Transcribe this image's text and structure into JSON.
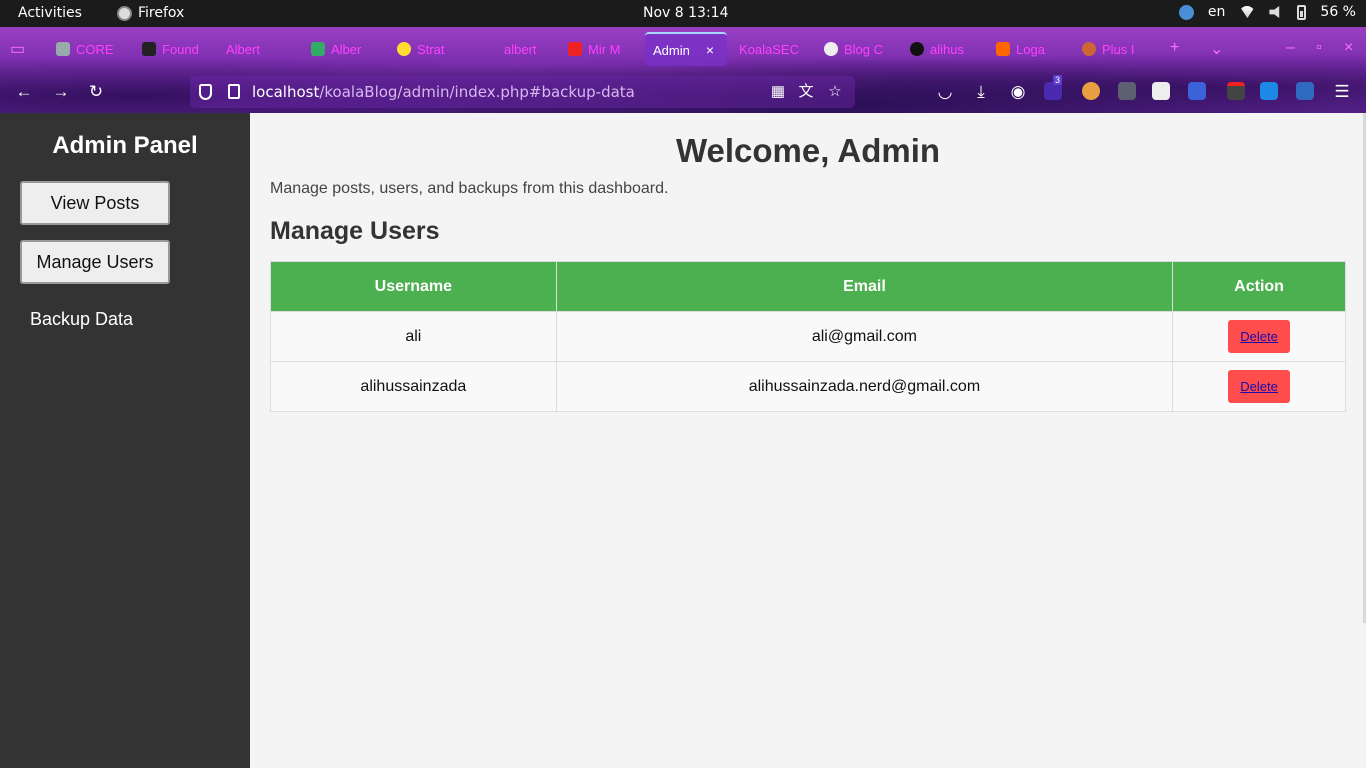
{
  "system_bar": {
    "activities": "Activities",
    "app_name": "Firefox",
    "clock": "Nov 8  13:14",
    "language": "en",
    "battery": "56 %"
  },
  "browser": {
    "tabs": [
      {
        "label": "CORE",
        "icon_color": "#9aa"
      },
      {
        "label": "Found",
        "icon_color": "#222"
      },
      {
        "label": "Albert",
        "icon_color": "#c3c"
      },
      {
        "label": "Alber",
        "icon_color": "#3a6"
      },
      {
        "label": "Strat",
        "icon_color": "#fd3"
      },
      {
        "label": "albert",
        "icon_color": "#c3c"
      },
      {
        "label": "Mir M",
        "icon_color": "#e22"
      },
      {
        "label": "Admin",
        "icon_color": "#7a3"
      },
      {
        "label": "KoalaSEC",
        "icon_color": "#c3c"
      },
      {
        "label": "Blog C",
        "icon_color": "#eee"
      },
      {
        "label": "alihus",
        "icon_color": "#111"
      },
      {
        "label": "Loga",
        "icon_color": "#f60"
      },
      {
        "label": "Plus I",
        "icon_color": "#c63"
      }
    ],
    "url_host": "localhost",
    "url_path": "/koalaBlog/admin/index.php#backup-data",
    "ext_badge": "3"
  },
  "sidebar": {
    "title": "Admin Panel",
    "view_posts": "View Posts",
    "manage_users": "Manage Users",
    "backup_data": "Backup Data"
  },
  "main": {
    "welcome": "Welcome, Admin",
    "intro": "Manage posts, users, and backups from this dashboard.",
    "section_title": "Manage Users",
    "columns": [
      "Username",
      "Email",
      "Action"
    ],
    "rows": [
      {
        "username": "ali",
        "email": "ali@gmail.com",
        "action": "Delete"
      },
      {
        "username": "alihussainzada",
        "email": "alihussainzada.nerd@gmail.com",
        "action": "Delete"
      }
    ]
  }
}
